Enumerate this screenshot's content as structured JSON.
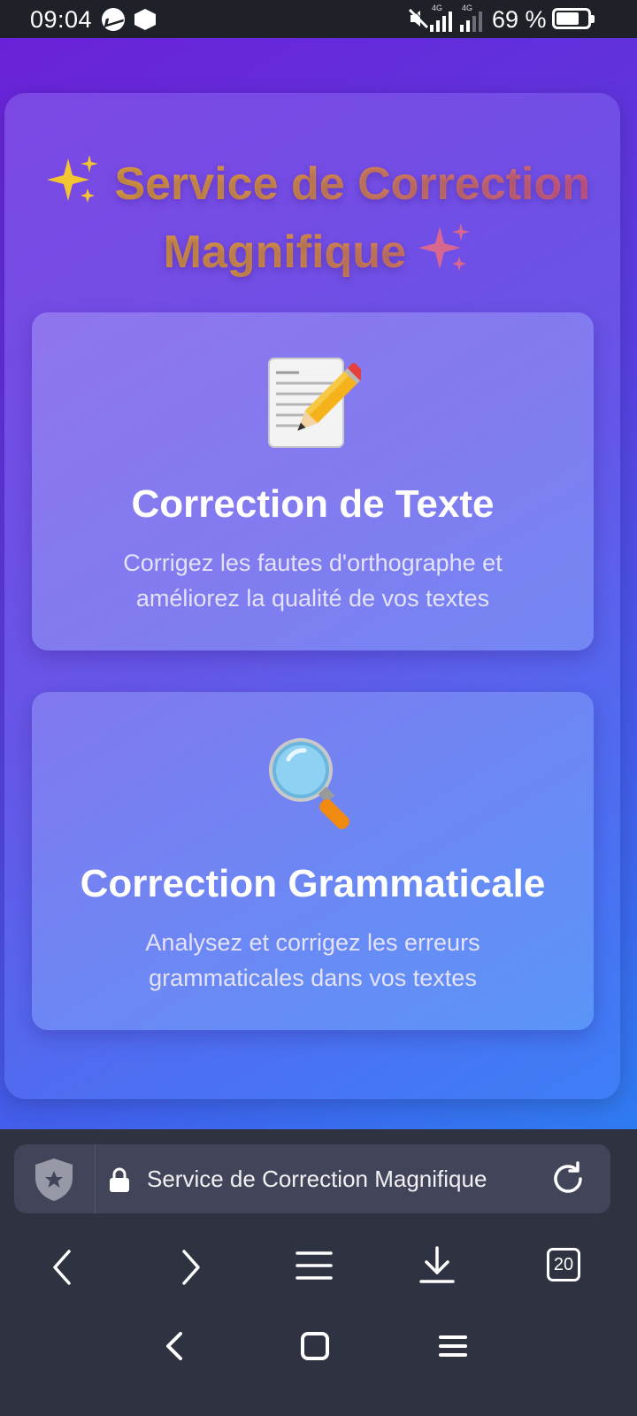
{
  "status_bar": {
    "time": "09:04",
    "network_tag_1": "4G",
    "network_tag_2": "4G",
    "battery_percent": "69 %",
    "icons": [
      "messenger-icon",
      "app-hex-icon",
      "mute-icon",
      "signal-icon",
      "signal-icon",
      "battery-icon"
    ]
  },
  "page": {
    "title_line1": "Service de Correction",
    "title_line2": "Magnifique",
    "sparkle_icon": "sparkles",
    "colors": {
      "bg_start": "#6a22d8",
      "bg_end": "#2f7bf0",
      "title_gold": "#e0a33a",
      "title_pink": "#cf5b86"
    }
  },
  "cards": [
    {
      "icon": "memo-pencil-icon",
      "title": "Correction de Texte",
      "description": "Corrigez les fautes d'orthographe et améliorez la qualité de vos textes"
    },
    {
      "icon": "magnifying-glass-icon",
      "title": "Correction Grammaticale",
      "description": "Analysez et corrigez les erreurs grammaticales dans vos textes"
    }
  ],
  "browser": {
    "url_text": "Service de Correction Magnifique",
    "tab_count": "20",
    "toolbar_icons": [
      "back-icon",
      "forward-icon",
      "menu-icon",
      "download-icon",
      "tabs-icon"
    ]
  },
  "system_nav": {
    "icons": [
      "back-icon",
      "home-icon",
      "recents-icon"
    ]
  }
}
